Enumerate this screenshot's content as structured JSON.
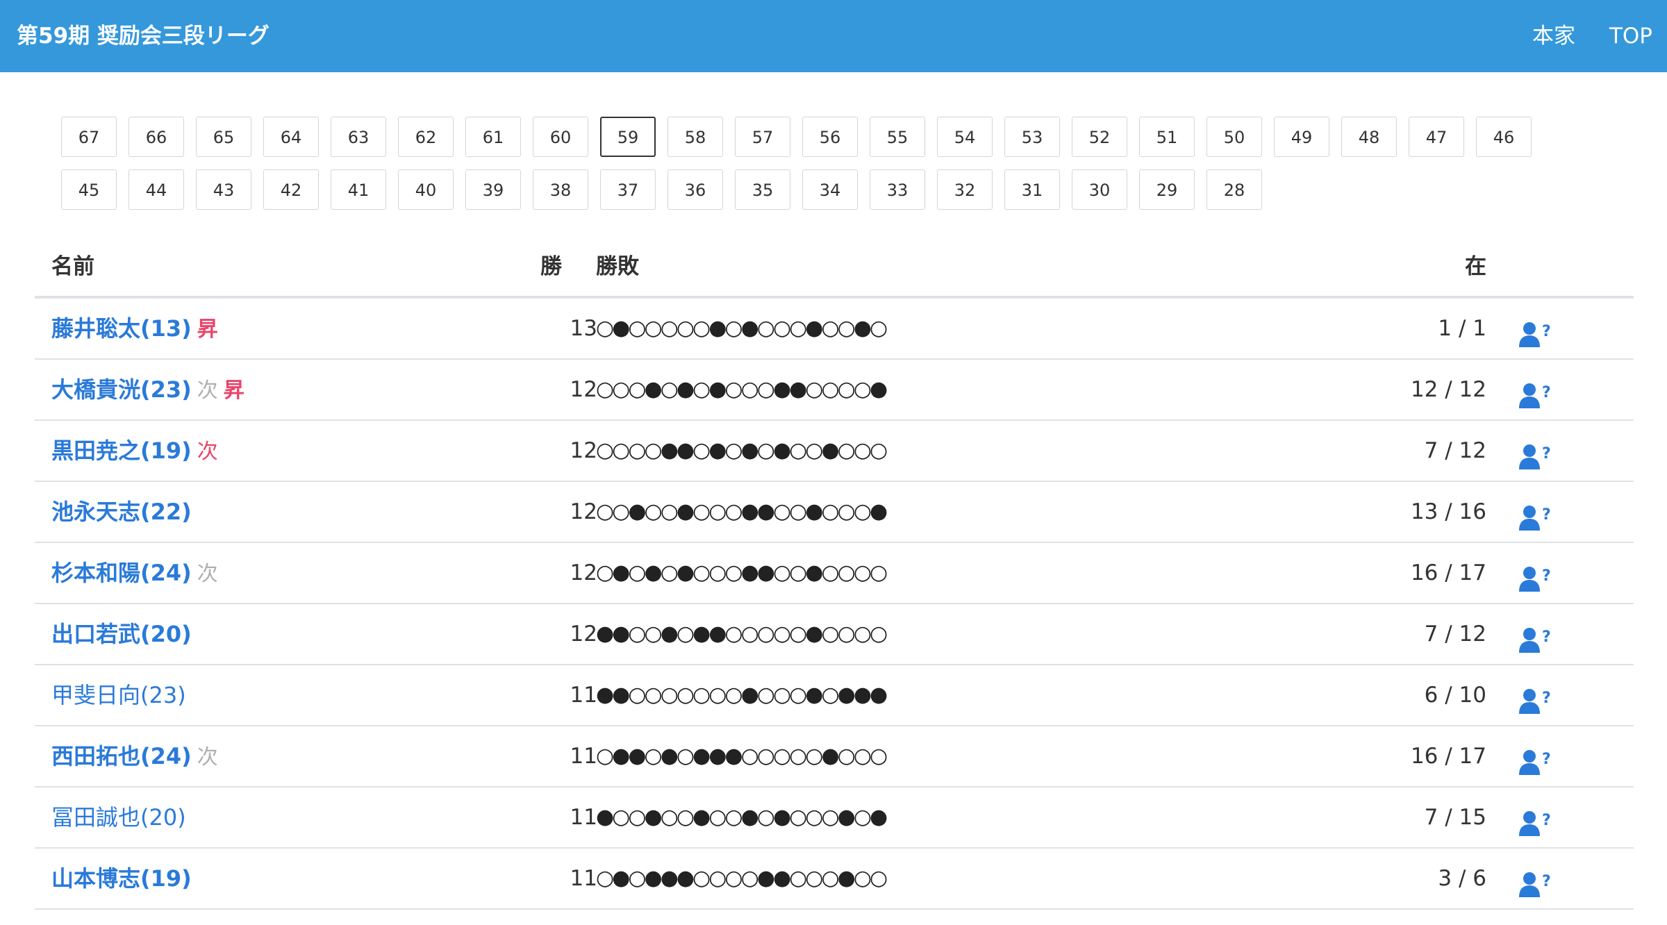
{
  "header": {
    "title": "第59期 奨励会三段リーグ",
    "links": [
      "本家",
      "TOP"
    ]
  },
  "pager": {
    "active": "59",
    "rows": [
      [
        "67",
        "66",
        "65",
        "64",
        "63",
        "62",
        "61",
        "60",
        "59",
        "58",
        "57",
        "56",
        "55",
        "54",
        "53",
        "52",
        "51",
        "50",
        "49",
        "48",
        "47",
        "46"
      ],
      [
        "45",
        "44",
        "43",
        "42",
        "41",
        "40",
        "39",
        "38",
        "37",
        "36",
        "35",
        "34",
        "33",
        "32",
        "31",
        "30",
        "29",
        "28"
      ]
    ]
  },
  "table": {
    "headers": {
      "name": "名前",
      "wins": "勝",
      "results": "勝敗",
      "zai": "在"
    },
    "rows": [
      {
        "name": "藤井聡太(13)",
        "bold": true,
        "badges": [
          {
            "text": "昇",
            "type": "up"
          }
        ],
        "wins": "13",
        "results": "○●○○○○○●○●○○○●○○●○",
        "zai": "1 / 1"
      },
      {
        "name": "大橋貴洸(23)",
        "bold": true,
        "badges": [
          {
            "text": "次",
            "type": "next"
          },
          {
            "text": "昇",
            "type": "up"
          }
        ],
        "wins": "12",
        "results": "○○○●○●○●○○○●●○○○○●",
        "zai": "12 / 12"
      },
      {
        "name": "黒田尭之(19)",
        "bold": true,
        "badges": [
          {
            "text": "次",
            "type": "next-red"
          }
        ],
        "wins": "12",
        "results": "○○○○●●○●○●○●○○●○○○",
        "zai": "7 / 12"
      },
      {
        "name": "池永天志(22)",
        "bold": true,
        "badges": [],
        "wins": "12",
        "results": "○○●○○●○○○●●○○●○○○●",
        "zai": "13 / 16"
      },
      {
        "name": "杉本和陽(24)",
        "bold": true,
        "badges": [
          {
            "text": "次",
            "type": "next"
          }
        ],
        "wins": "12",
        "results": "○●○●○●○○○●●○○●○○○○",
        "zai": "16 / 17"
      },
      {
        "name": "出口若武(20)",
        "bold": true,
        "badges": [],
        "wins": "12",
        "results": "●●○○●○●●○○○○○●○○○○",
        "zai": "7 / 12"
      },
      {
        "name": "甲斐日向(23)",
        "bold": false,
        "badges": [],
        "wins": "11",
        "results": "●●○○○○○○○●○○○●○●●●",
        "zai": "6 / 10"
      },
      {
        "name": "西田拓也(24)",
        "bold": true,
        "badges": [
          {
            "text": "次",
            "type": "next"
          }
        ],
        "wins": "11",
        "results": "○●●○●○●●●○○○○○●○○○",
        "zai": "16 / 17"
      },
      {
        "name": "冨田誠也(20)",
        "bold": false,
        "badges": [],
        "wins": "11",
        "results": "●○○●○○●○○●○●○○○●○●",
        "zai": "7 / 15"
      },
      {
        "name": "山本博志(19)",
        "bold": true,
        "badges": [],
        "wins": "11",
        "results": "○●○●●●○○○○●●○○○●○○",
        "zai": "3 / 6"
      }
    ]
  },
  "icons": {
    "row_action": "user-question-icon"
  },
  "colors": {
    "navbar": "#3498db",
    "link": "#2a7ad9",
    "up_badge": "#e8456b",
    "next_badge": "#b0b0b0"
  }
}
